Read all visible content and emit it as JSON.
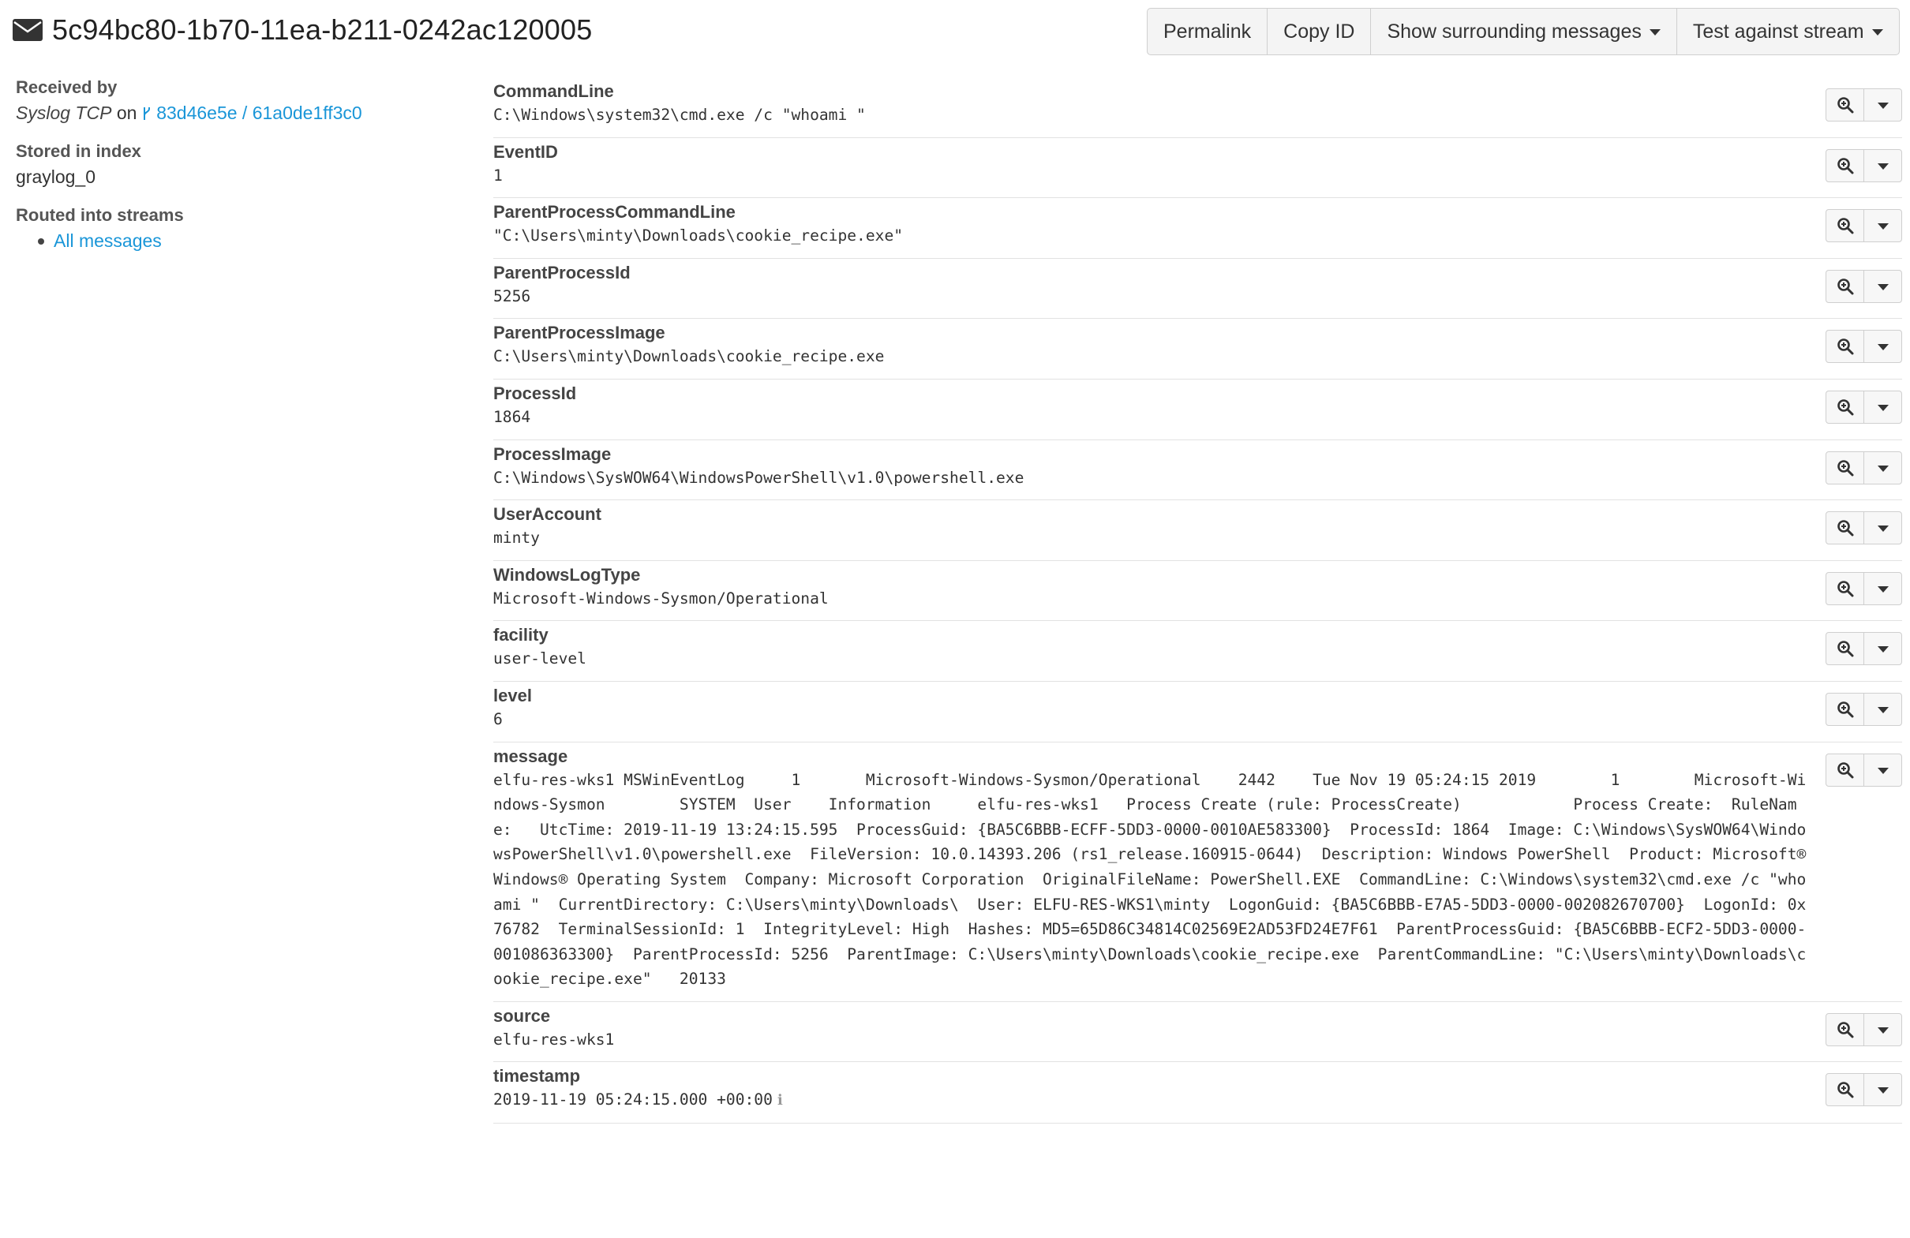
{
  "header": {
    "message_id": "5c94bc80-1b70-11ea-b211-0242ac120005",
    "icon": "envelope-icon"
  },
  "toolbar": {
    "permalink": "Permalink",
    "copy_id": "Copy ID",
    "show_surrounding": "Show surrounding messages",
    "test_stream": "Test against stream"
  },
  "sidebar": {
    "received_by_label": "Received by",
    "input_name": "Syslog TCP",
    "on_word": "on",
    "node_link": "83d46e5e / 61a0de1ff3c0",
    "stored_label": "Stored in index",
    "index_name": "graylog_0",
    "routed_label": "Routed into streams",
    "streams": [
      "All messages"
    ]
  },
  "fields": [
    {
      "name": "CommandLine",
      "value": "C:\\Windows\\system32\\cmd.exe /c \"whoami \""
    },
    {
      "name": "EventID",
      "value": "1"
    },
    {
      "name": "ParentProcessCommandLine",
      "value": "\"C:\\Users\\minty\\Downloads\\cookie_recipe.exe\""
    },
    {
      "name": "ParentProcessId",
      "value": "5256"
    },
    {
      "name": "ParentProcessImage",
      "value": "C:\\Users\\minty\\Downloads\\cookie_recipe.exe"
    },
    {
      "name": "ProcessId",
      "value": "1864"
    },
    {
      "name": "ProcessImage",
      "value": "C:\\Windows\\SysWOW64\\WindowsPowerShell\\v1.0\\powershell.exe"
    },
    {
      "name": "UserAccount",
      "value": "minty"
    },
    {
      "name": "WindowsLogType",
      "value": "Microsoft-Windows-Sysmon/Operational"
    },
    {
      "name": "facility",
      "value": "user-level"
    },
    {
      "name": "level",
      "value": "6"
    },
    {
      "name": "message",
      "value": "elfu-res-wks1 MSWinEventLog     1       Microsoft-Windows-Sysmon/Operational    2442    Tue Nov 19 05:24:15 2019        1        Microsoft-Windows-Sysmon        SYSTEM  User    Information     elfu-res-wks1   Process Create (rule: ProcessCreate)            Process Create:  RuleName:   UtcTime: 2019-11-19 13:24:15.595  ProcessGuid: {BA5C6BBB-ECFF-5DD3-0000-0010AE583300}  ProcessId: 1864  Image: C:\\Windows\\SysWOW64\\WindowsPowerShell\\v1.0\\powershell.exe  FileVersion: 10.0.14393.206 (rs1_release.160915-0644)  Description: Windows PowerShell  Product: Microsoft® Windows® Operating System  Company: Microsoft Corporation  OriginalFileName: PowerShell.EXE  CommandLine: C:\\Windows\\system32\\cmd.exe /c \"whoami \"  CurrentDirectory: C:\\Users\\minty\\Downloads\\  User: ELFU-RES-WKS1\\minty  LogonGuid: {BA5C6BBB-E7A5-5DD3-0000-002082670700}  LogonId: 0x76782  TerminalSessionId: 1  IntegrityLevel: High  Hashes: MD5=65D86C34814C02569E2AD53FD24E7F61  ParentProcessGuid: {BA5C6BBB-ECF2-5DD3-0000-001086363300}  ParentProcessId: 5256  ParentImage: C:\\Users\\minty\\Downloads\\cookie_recipe.exe  ParentCommandLine: \"C:\\Users\\minty\\Downloads\\cookie_recipe.exe\"   20133",
      "wrap": true
    },
    {
      "name": "source",
      "value": "elfu-res-wks1"
    },
    {
      "name": "timestamp",
      "value": "2019-11-19 05:24:15.000 +00:00",
      "info_icon": true
    }
  ]
}
